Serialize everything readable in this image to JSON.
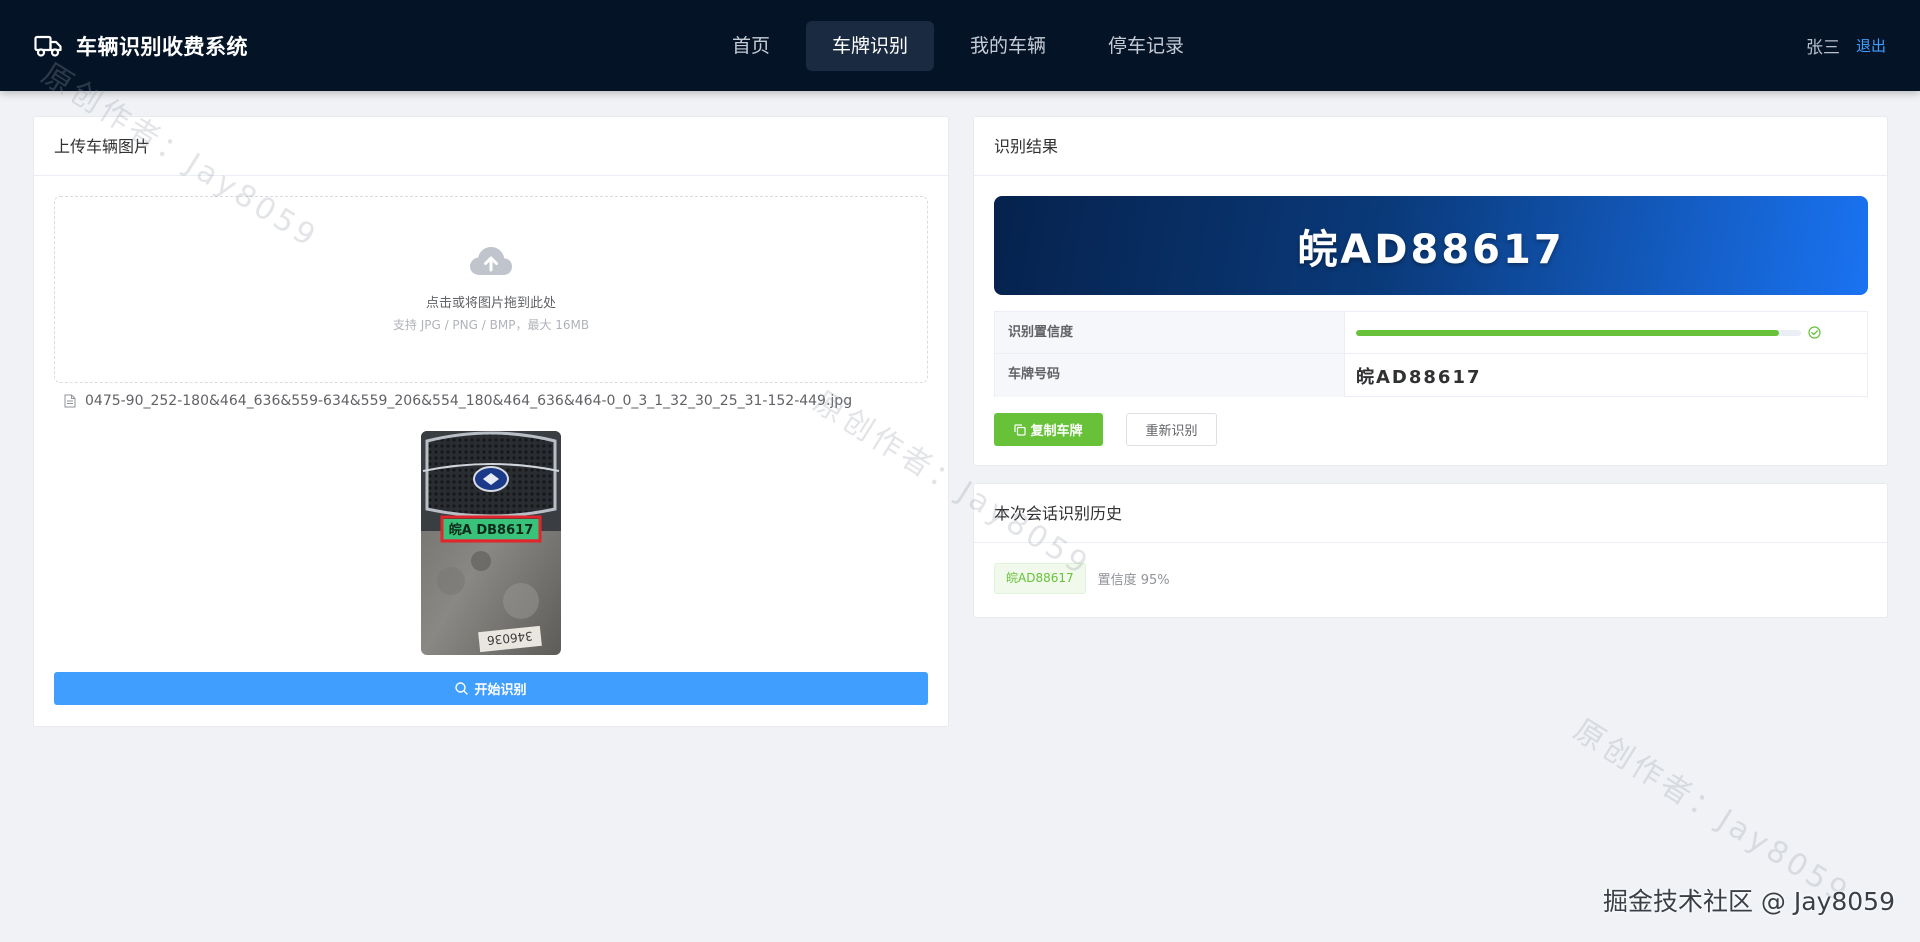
{
  "header": {
    "title": "车辆识别收费系统",
    "nav": [
      {
        "label": "首页"
      },
      {
        "label": "车牌识别"
      },
      {
        "label": "我的车辆"
      },
      {
        "label": "停车记录"
      }
    ],
    "user_name": "张三",
    "logout_label": "退出"
  },
  "upload": {
    "card_title": "上传车辆图片",
    "drop_main": "点击或将图片拖到此处",
    "drop_tip": "支持 JPG / PNG / BMP，最大 16MB",
    "file_name": "0475-90_252-180&464_636&559-634&559_206&554_180&464_636&464-0_0_3_1_32_30_25_31-152-449.jpg",
    "photo_plate_text": "皖A DB8617",
    "photo_sticker_text": "346036",
    "start_label": "开始识别"
  },
  "result": {
    "card_title": "识别结果",
    "plate_banner": "皖AD88617",
    "confidence_label": "识别置信度",
    "confidence_value": 0.95,
    "plate_label": "车牌号码",
    "plate_value": "皖AD88617",
    "copy_label": "复制车牌",
    "retry_label": "重新识别"
  },
  "history": {
    "card_title": "本次会话识别历史",
    "items": [
      {
        "plate": "皖AD88617",
        "confidence": "置信度 95%"
      }
    ]
  },
  "watermark": {
    "text": "原创作者：Jay8059",
    "credit": "掘金技术社区 @ Jay8059"
  },
  "colors": {
    "header_bg": "#051327",
    "primary": "#409eff",
    "success": "#67c23a",
    "banner_start": "#06224d",
    "banner_end": "#1a73f2"
  }
}
